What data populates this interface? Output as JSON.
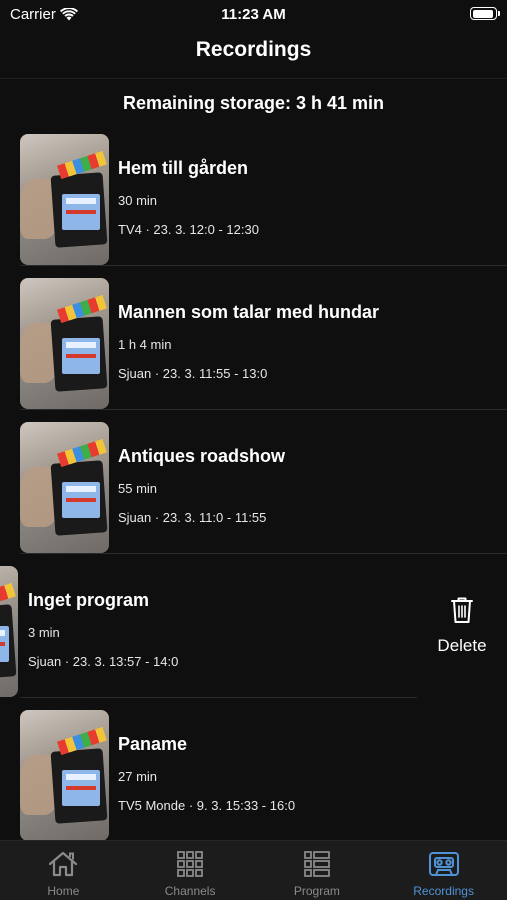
{
  "status": {
    "carrier": "Carrier",
    "time": "11:23 AM"
  },
  "nav": {
    "title": "Recordings"
  },
  "storage": {
    "text": "Remaining storage: 3 h 41 min"
  },
  "recordings": [
    {
      "title": "Hem till gården",
      "duration": "30 min",
      "meta": "TV4 · 23. 3.  12:0 - 12:30"
    },
    {
      "title": "Mannen som talar med hundar",
      "duration": "1 h 4 min",
      "meta": "Sjuan · 23. 3.  11:55 - 13:0"
    },
    {
      "title": "Antiques roadshow",
      "duration": "55 min",
      "meta": "Sjuan · 23. 3.  11:0 - 11:55"
    },
    {
      "title": "Inget program",
      "duration": "3 min",
      "meta": "Sjuan · 23. 3.  13:57 - 14:0"
    },
    {
      "title": "Paname",
      "duration": "27 min",
      "meta": "TV5 Monde · 9. 3.  15:33 - 16:0"
    }
  ],
  "swipe_action": {
    "label": "Delete",
    "icon": "trash-icon"
  },
  "tabs": [
    {
      "label": "Home",
      "icon": "home-icon",
      "active": false
    },
    {
      "label": "Channels",
      "icon": "grid-icon",
      "active": false
    },
    {
      "label": "Program",
      "icon": "list-icon",
      "active": false
    },
    {
      "label": "Recordings",
      "icon": "cassette-icon",
      "active": true
    }
  ],
  "colors": {
    "accent": "#4f93d6",
    "background": "#0f0f0f",
    "tab_bar": "#1c1c1c"
  }
}
